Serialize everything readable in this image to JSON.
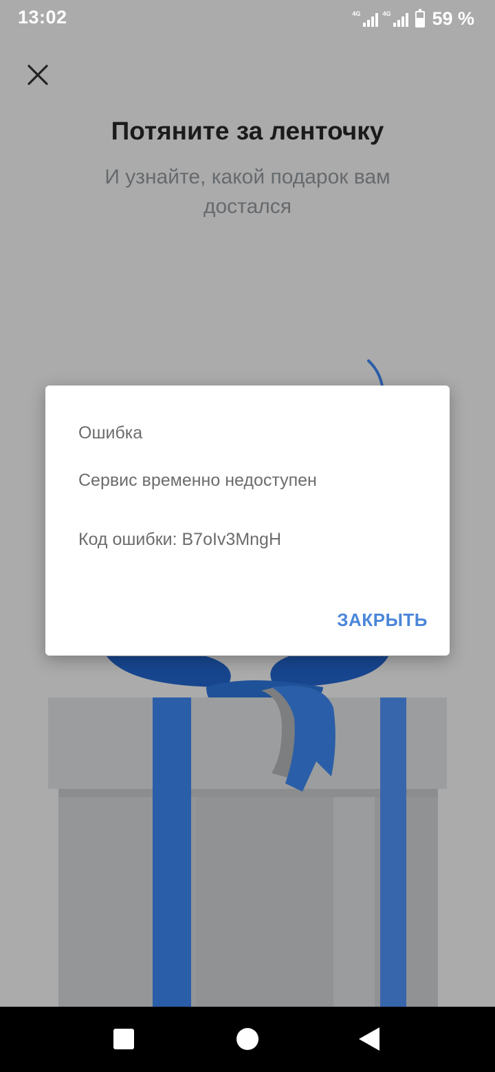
{
  "status_bar": {
    "time": "13:02",
    "network_label_1": "4G",
    "network_label_2": "4G",
    "battery_percent_text": "59 %",
    "battery_level": 0.59
  },
  "screen": {
    "title": "Потяните за ленточку",
    "subtitle": "И узнайте, какой подарок вам достался"
  },
  "dialog": {
    "title": "Ошибка",
    "message": "Сервис временно недоступен",
    "error_code": "Код ошибки: B7oIv3MngH",
    "close_label": "ЗАКРЫТЬ"
  },
  "colors": {
    "background_dimmed": "#ababab",
    "ribbon_blue": "#2b5ea8",
    "ribbon_dark": "#17468f",
    "accent": "#4a86d9",
    "text_dark": "#1b1b1b",
    "text_muted": "#6c6c6c"
  },
  "icons": {
    "close": "close-icon",
    "gift": "gift-box-illustration",
    "nav_recent": "square-icon",
    "nav_home": "circle-icon",
    "nav_back": "triangle-back-icon"
  }
}
